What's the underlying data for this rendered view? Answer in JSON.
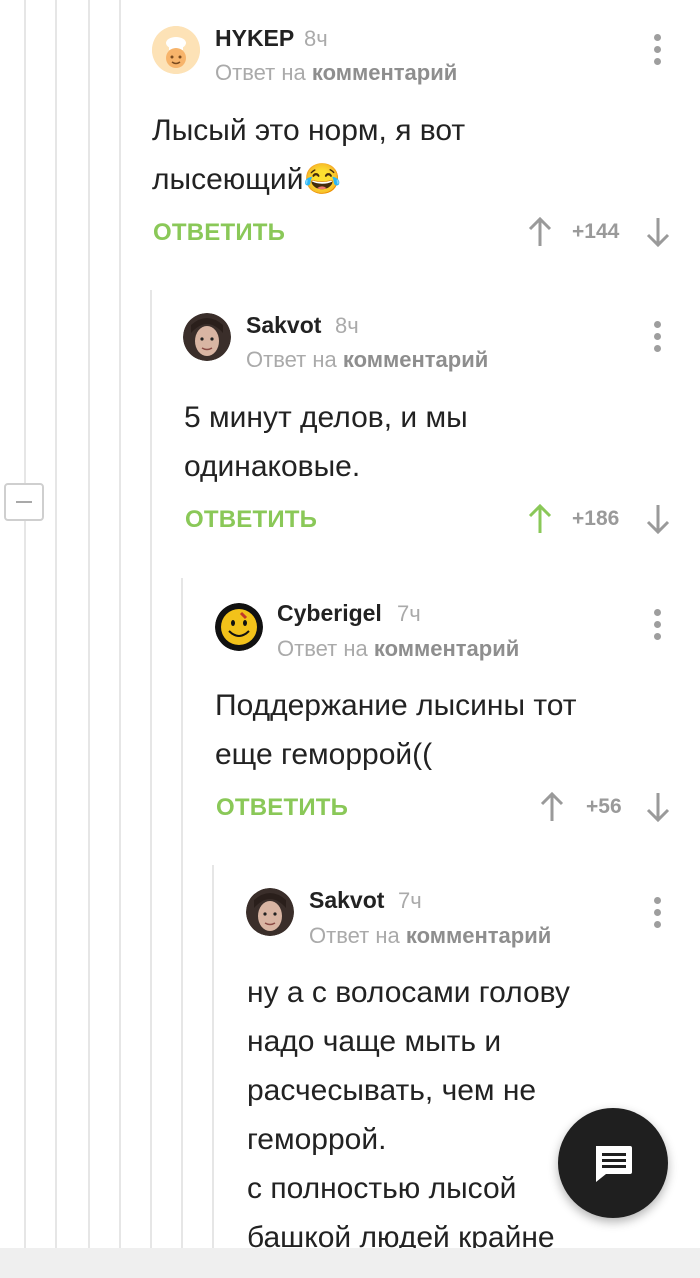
{
  "comments": [
    {
      "author": "HYKEP",
      "time": "8ч",
      "reply_prefix": "Ответ на",
      "reply_link": "комментарий",
      "body_lines": [
        "Лысый это норм, я вот",
        "лысеющий"
      ],
      "emoji": "😂",
      "action": "ОТВЕТИТЬ",
      "score": "+144",
      "avatar_icon": "chef-avatar-icon"
    },
    {
      "author": "Sakvot",
      "time": "8ч",
      "reply_prefix": "Ответ на",
      "reply_link": "комментарий",
      "body_lines": [
        "5 минут делов, и мы",
        "одинаковые."
      ],
      "action": "ОТВЕТИТЬ",
      "score": "+186",
      "upvoted": true,
      "avatar_icon": "user-photo-avatar"
    },
    {
      "author": "Cyberigel",
      "time": "7ч",
      "reply_prefix": "Ответ на",
      "reply_link": "комментарий",
      "body_lines": [
        "Поддержание лысины тот",
        "еще геморрой(("
      ],
      "action": "ОТВЕТИТЬ",
      "score": "+56",
      "avatar_icon": "smiley-avatar-icon"
    },
    {
      "author": "Sakvot",
      "time": "7ч",
      "reply_prefix": "Ответ на",
      "reply_link": "комментарий",
      "body_lines": [
        "ну а с волосами голову",
        "надо чаще мыть и",
        "расчесывать, чем не",
        "геморрой.",
        "с полностью лысой",
        "башкой людей крайне"
      ],
      "avatar_icon": "user-photo-avatar"
    }
  ],
  "fab_icon": "comment-icon",
  "colors": {
    "accent_green": "#8ac858",
    "muted_gray": "#aaaaaa",
    "fab_bg": "#1f1f1f"
  }
}
